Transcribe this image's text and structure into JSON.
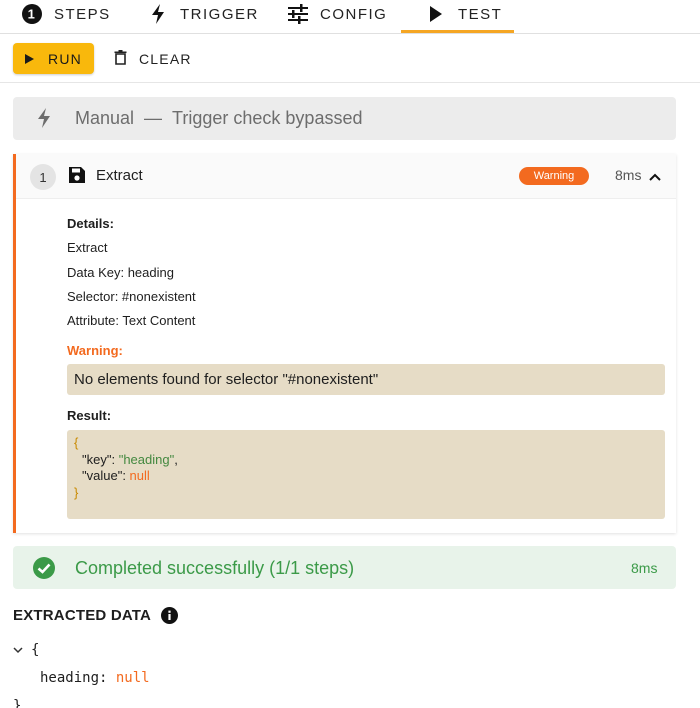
{
  "tabs": [
    {
      "label": "STEPS",
      "icon": "number-one-circle-icon"
    },
    {
      "label": "TRIGGER",
      "icon": "bolt-icon"
    },
    {
      "label": "CONFIG",
      "icon": "sliders-icon"
    },
    {
      "label": "TEST",
      "icon": "play-icon",
      "active": true
    }
  ],
  "toolbar": {
    "run_label": "RUN",
    "clear_label": "CLEAR"
  },
  "trigger": {
    "label": "Manual",
    "separator": "—",
    "message": "Trigger check bypassed"
  },
  "step": {
    "number": "1",
    "title": "Extract",
    "badge": "Warning",
    "duration": "8ms",
    "details_heading": "Details:",
    "details": [
      "Extract",
      "Data Key: heading",
      "Selector: #nonexistent",
      "Attribute: Text Content"
    ],
    "warning_heading": "Warning:",
    "warning_message": "No elements found for selector \"#nonexistent\"",
    "result_heading": "Result:",
    "result": {
      "open_brace": "{",
      "key_name": "\"key\"",
      "key_value": "\"heading\"",
      "value_name": "\"value\"",
      "value_value": "null",
      "close_brace": "}"
    }
  },
  "completion": {
    "message": "Completed successfully (1/1 steps)",
    "duration": "8ms"
  },
  "extracted": {
    "title": "EXTRACTED DATA",
    "open_brace": "{",
    "key": "heading",
    "value": "null",
    "close_brace": "}"
  },
  "colors": {
    "accent": "#f9b80c",
    "warning": "#f36a1f",
    "success": "#3b9a48"
  }
}
